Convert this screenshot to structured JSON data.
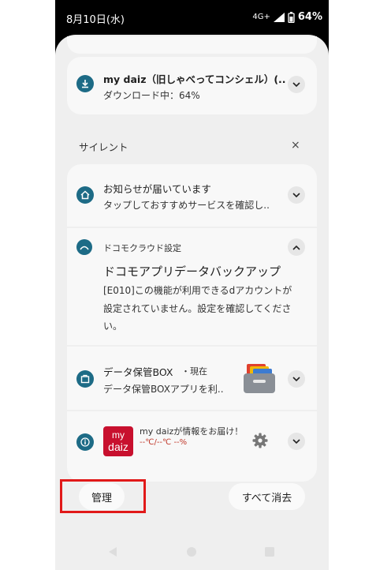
{
  "status_bar": {
    "date": "8月10日(水)",
    "network": "4G+",
    "battery": "64%"
  },
  "notifications": {
    "download": {
      "title": "my daiz（旧しゃべってコンシェル）(..",
      "body": "ダウンロード中：64%"
    },
    "silent_section": {
      "label": "サイレント",
      "close": "×"
    },
    "oshirase": {
      "title": "お知らせが届いています",
      "body": "タップしておすすめサービスを確認し.."
    },
    "docomo_cloud": {
      "app_name": "ドコモクラウド設定",
      "title": "ドコモアプリデータバックアップ",
      "body_lines": [
        "[E010]この機能が利用できるdアカウントが",
        "設定されていません。設定を確認してくださ",
        "い。"
      ]
    },
    "data_box": {
      "title": "データ保管BOX",
      "time": "・現在",
      "body": "データ保管BOXアプリを利.."
    },
    "mydaiz": {
      "title": "my daizが情報をお届け！",
      "temps": "--℃/--℃ --%",
      "logo_top": "my",
      "logo_bottom": "daiz"
    }
  },
  "buttons": {
    "manage": "管理",
    "clear_all": "すべて消去"
  },
  "colors": {
    "accent": "#1d6b86",
    "highlight": "#e11919",
    "mydaiz_red": "#c8102e"
  }
}
